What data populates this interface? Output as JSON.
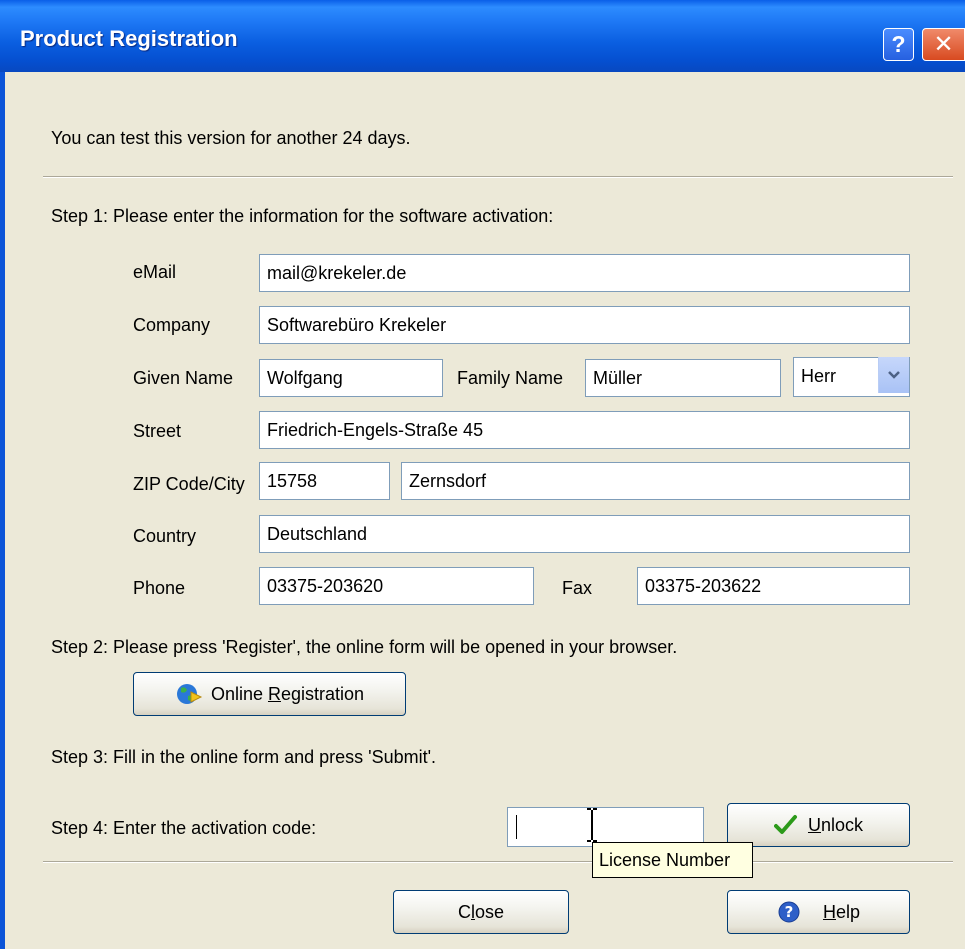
{
  "window": {
    "title": "Product Registration"
  },
  "trial_notice": "You can test this version for another 24 days.",
  "step1": {
    "text": "Step 1: Please enter the information for the software activation:",
    "labels": {
      "email": "eMail",
      "company": "Company",
      "given_name": "Given Name",
      "family_name": "Family Name",
      "street": "Street",
      "zip_city": "ZIP Code/City",
      "country": "Country",
      "phone": "Phone",
      "fax": "Fax"
    },
    "values": {
      "email": "mail@krekeler.de",
      "company": "Softwarebüro Krekeler",
      "given_name": "Wolfgang",
      "family_name": "Müller",
      "salutation": "Herr",
      "street": "Friedrich-Engels-Straße 45",
      "zip": "15758",
      "city": "Zernsdorf",
      "country": "Deutschland",
      "phone": "03375-203620",
      "fax": "03375-203622"
    }
  },
  "step2": {
    "text": "Step 2: Please press 'Register', the online form will be opened in your browser.",
    "button": {
      "prefix": "Online ",
      "accel": "R",
      "rest": "egistration"
    }
  },
  "step3": {
    "text": "Step 3: Fill in the online form and press 'Submit'."
  },
  "step4": {
    "text": "Step 4: Enter the activation code:",
    "code_value": "",
    "unlock_button": {
      "accel": "U",
      "rest": "nlock"
    },
    "tooltip": "License Number"
  },
  "footer": {
    "close_button": {
      "prefix": "C",
      "accel": "l",
      "rest": "ose"
    },
    "help_button": {
      "accel": "H",
      "rest": "elp"
    }
  },
  "icons": {
    "help_title": "help-icon",
    "close_title": "close-icon",
    "register": "globe-icon",
    "unlock": "checkmark-icon",
    "help": "help-icon",
    "dropdown": "chevron-down-icon"
  },
  "colors": {
    "titlebar": "#0a5ee0",
    "dialog_bg": "#ece9d8",
    "tooltip_bg": "#ffffe1",
    "check_green": "#2c9a1a"
  }
}
